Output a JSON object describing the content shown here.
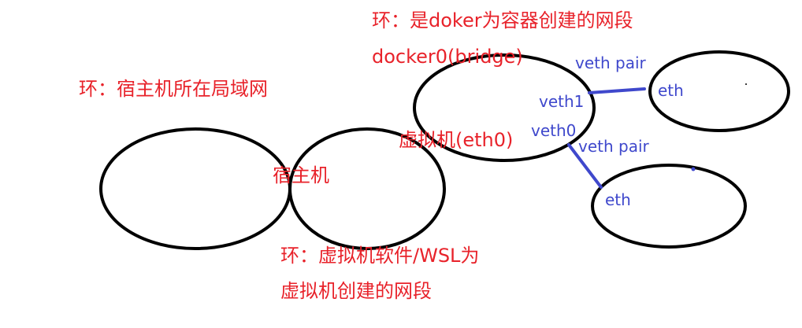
{
  "colors": {
    "outline": "#000000",
    "red_text": "#e8222a",
    "blue_text": "#3f48cc",
    "link_line": "#3f48cc"
  },
  "labels": {
    "ring_docker_line1": "环：是doker为容器创建的网段",
    "ring_docker_line2": "docker0(bridge)",
    "ring_host_lan": "环：宿主机所在局域网",
    "host_machine": "宿主机",
    "vm_eth0": "虚拟机(eth0)",
    "ring_vm_line1": "环：虚拟机软件/WSL为",
    "ring_vm_line2": "虚拟机创建的网段"
  },
  "interfaces": {
    "veth1": "veth1",
    "veth0": "veth0",
    "veth_pair_top": "veth pair",
    "veth_pair_bottom": "veth pair",
    "container1_eth": "eth",
    "container2_eth": "eth"
  }
}
